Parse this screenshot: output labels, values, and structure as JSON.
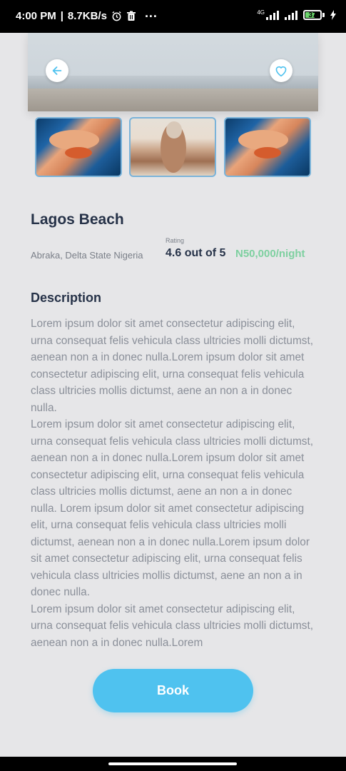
{
  "status_bar": {
    "time": "4:00 PM",
    "network_speed": "8.7KB/s",
    "network_type": "4G",
    "battery": "37",
    "icons": [
      "alarm-icon",
      "trash-icon",
      "more-icon",
      "signal-icon",
      "battery-icon",
      "charging-icon"
    ]
  },
  "place": {
    "title": "Lagos Beach",
    "location": "Abraka, Delta State Nigeria",
    "rating_label": "Rating",
    "rating": "4.6 out of 5",
    "price": "N50,000/night"
  },
  "description": {
    "heading": "Description",
    "body": "Lorem ipsum dolor sit amet consectetur adipiscing elit, urna consequat felis vehicula class ultricies molli dictumst, aenean non a in donec nulla.Lorem ipsum dolor sit amet consectetur adipiscing elit, urna consequat felis vehicula class ultricies  mollis dictumst, aene an non a in donec nulla.\n Lorem ipsum dolor sit amet consectetur adipiscing elit, urna consequat felis vehicula class ultricies molli dictumst, aenean non a in donec nulla.Lorem ipsum dolor sit amet consectetur adipiscing elit, urna consequat felis vehicula class ultricies  mollis dictumst, aene an non a in donec nulla. Lorem ipsum dolor sit amet consectetur adipiscing elit, urna consequat felis vehicula class ultricies  molli dictumst, aenean non a in donec nulla.Lorem ipsum dolor sit amet consectetur adipiscing elit, urna consequat felis vehicula class ultricies  mollis dictumst, aene an non a in donec nulla.\n Lorem ipsum dolor sit amet consectetur adipiscing elit, urna consequat felis vehicula class ultricies molli dictumst, aenean non a in donec nulla.Lorem"
  },
  "actions": {
    "book_label": "Book",
    "back_icon": "back-arrow-icon",
    "favorite_icon": "heart-icon"
  },
  "colors": {
    "accent": "#4fc2ef",
    "price": "#7ed0a0",
    "heading": "#263248",
    "body_text": "#8a8f99",
    "background": "#e6e6e8"
  }
}
